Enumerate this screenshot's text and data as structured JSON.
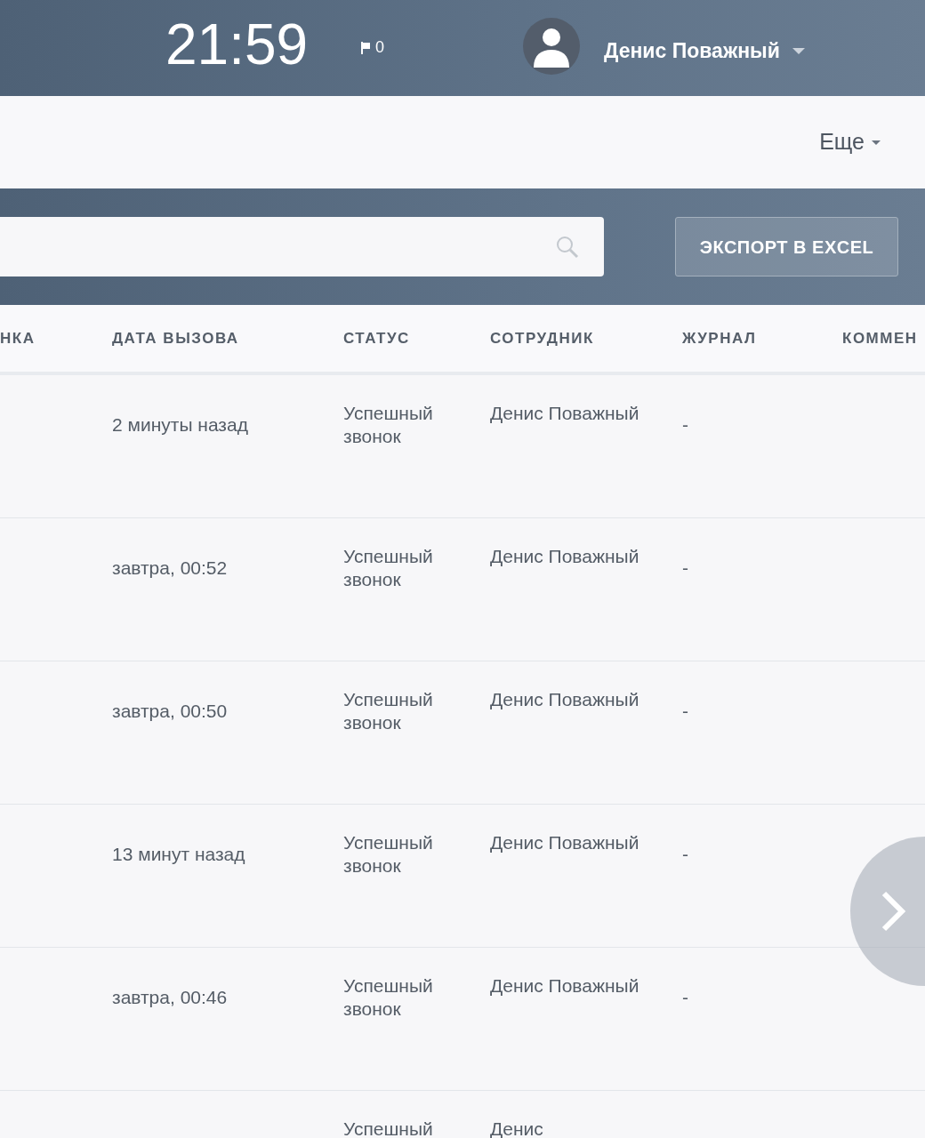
{
  "top_bar": {
    "clock": "21:59",
    "flags": "0",
    "user": {
      "name": "Денис Поважный"
    }
  },
  "nav": {
    "more_menu": "Еще"
  },
  "toolbar": {
    "export_button": "ЭКСПОРТ В EXCEL"
  },
  "table": {
    "columns": [
      "НКА",
      "ДАТА ВЫЗОВА",
      "СТАТУС",
      "СОТРУДНИК",
      "ЖУРНАЛ",
      "КОММЕН"
    ],
    "rows": [
      {
        "date": "2 минуты назад",
        "status": "Успешный звонок",
        "employee": "Денис Поважный",
        "journal": "-"
      },
      {
        "date": "завтра, 00:52",
        "status": "Успешный звонок",
        "employee": "Денис Поважный",
        "journal": "-"
      },
      {
        "date": "завтра, 00:50",
        "status": "Успешный звонок",
        "employee": "Денис Поважный",
        "journal": "-"
      },
      {
        "date": "13 минут назад",
        "status": "Успешный звонок",
        "employee": "Денис Поважный",
        "journal": "-"
      },
      {
        "date": "завтра, 00:46",
        "status": "Успешный звонок",
        "employee": "Денис Поважный",
        "journal": "-"
      },
      {
        "status": "Успешный",
        "employee": "Денис"
      }
    ]
  }
}
